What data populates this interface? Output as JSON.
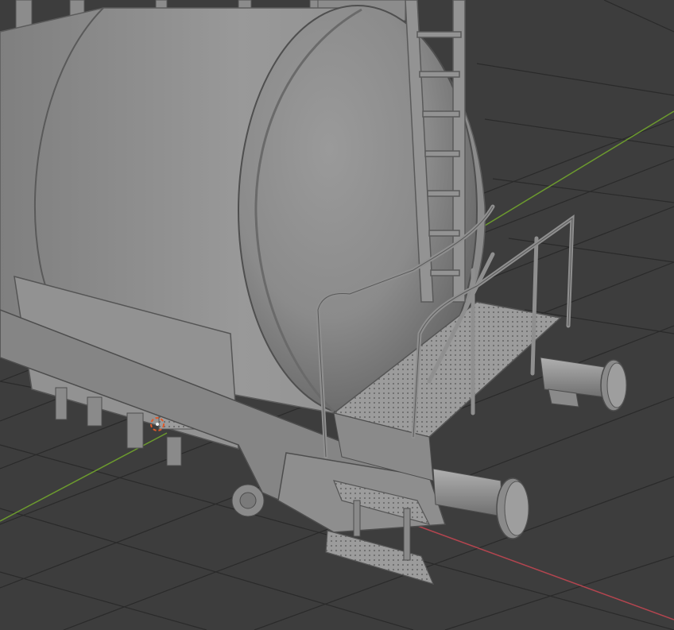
{
  "viewport": {
    "mode": "solid-shading",
    "background_color": "#3d3d3d",
    "grid_line_color": "#2a2a2a",
    "x_axis_color": "#b2454f",
    "y_axis_color": "#6c9a2e",
    "object_color": "#9a9a9a",
    "origin_marker": "3d-cursor-icon"
  }
}
